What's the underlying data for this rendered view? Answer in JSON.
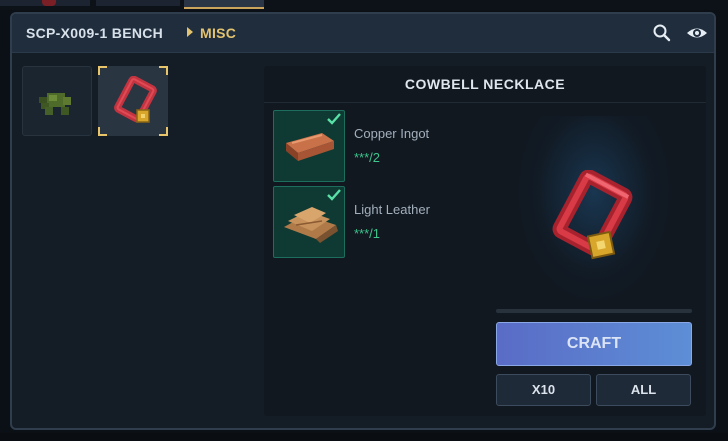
{
  "header": {
    "bench": "SCP-X009-1 BENCH",
    "category": "MISC",
    "icons": [
      "search-icon",
      "eye-icon"
    ]
  },
  "item_grid": [
    {
      "icon": "turtle-icon",
      "selected": false
    },
    {
      "icon": "cowbell-necklace-icon",
      "selected": true
    }
  ],
  "recipe": {
    "title": "COWBELL NECKLACE",
    "preview_icon": "cowbell-necklace-icon",
    "ingredients": [
      {
        "name": "Copper Ingot",
        "count": "***/2",
        "icon": "copper-ingot-icon",
        "satisfied": true
      },
      {
        "name": "Light Leather",
        "count": "***/1",
        "icon": "light-leather-icon",
        "satisfied": true
      }
    ]
  },
  "actions": {
    "craft": "CRAFT",
    "x10": "X10",
    "all": "ALL"
  },
  "colors": {
    "accent_gold": "#e3c36f",
    "ok_green": "#3ec48c",
    "craft_blue": "#5a7fd0",
    "header_bg": "#1f2d3d"
  }
}
